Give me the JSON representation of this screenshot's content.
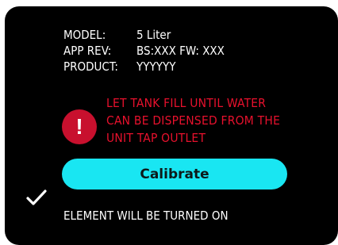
{
  "info": {
    "model_label": "MODEL:",
    "model_value": "5 Liter",
    "app_rev_label": "APP REV:",
    "app_rev_value": "BS:XXX FW: XXX",
    "product_label": "PRODUCT:",
    "product_value": "YYYYYY"
  },
  "warning": {
    "icon": "exclamation-icon",
    "line1": "LET TANK FILL UNTIL WATER",
    "line2": "CAN BE DISPENSED FROM THE",
    "line3": "UNIT TAP OUTLET",
    "color": "#e8112d"
  },
  "calibrate_button": {
    "label": "Calibrate",
    "color": "#19e6f2"
  },
  "status": {
    "icon": "checkmark-icon",
    "text": "ELEMENT WILL BE TURNED ON"
  }
}
